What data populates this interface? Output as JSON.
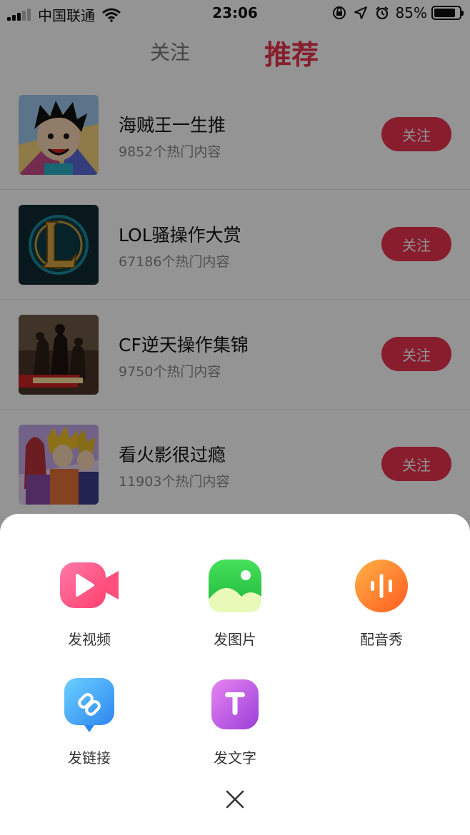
{
  "status_bar": {
    "carrier": "中国联通",
    "time": "23:06",
    "battery": "85%",
    "battery_level": 0.85
  },
  "tabs": [
    {
      "label": "关注",
      "active": false
    },
    {
      "label": "推荐",
      "active": true
    }
  ],
  "list": [
    {
      "title": "海贼王一生推",
      "subtitle": "9852个热门内容",
      "button": "关注",
      "thumb": "one-piece-luffy"
    },
    {
      "title": "LOL骚操作大赏",
      "subtitle": "67186个热门内容",
      "button": "关注",
      "thumb": "lol-logo"
    },
    {
      "title": "CF逆天操作集锦",
      "subtitle": "9750个热门内容",
      "button": "关注",
      "thumb": "crossfire-soldiers"
    },
    {
      "title": "看火影很过瘾",
      "subtitle": "11903个热门内容",
      "button": "关注",
      "thumb": "naruto-characters"
    }
  ],
  "sheet": {
    "actions": [
      {
        "label": "发视频",
        "icon": "video-camera-icon",
        "color": "#ff5a8a"
      },
      {
        "label": "发图片",
        "icon": "image-icon",
        "color": "#3ecf4a"
      },
      {
        "label": "配音秀",
        "icon": "audio-wave-icon",
        "color": "#ff7a2a"
      },
      {
        "label": "发链接",
        "icon": "link-icon",
        "color": "#3a9cf5"
      },
      {
        "label": "发文字",
        "icon": "text-icon",
        "color": "#b04ee0"
      }
    ],
    "close_icon": "close-icon"
  },
  "colors": {
    "accent": "#e8334f"
  }
}
